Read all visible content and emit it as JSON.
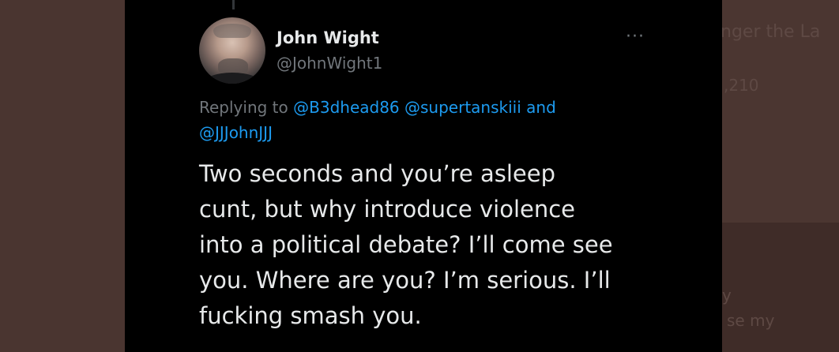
{
  "tweet": {
    "author_name": "John Wight",
    "author_handle": "@JohnWight1",
    "more_icon": "more-dots-icon",
    "replying_prefix": "Replying to",
    "mentions": [
      "@B3dhead86",
      "@supertanskiii"
    ],
    "mentions_joiner": "and",
    "mentions_last": "@JJJohnJJJ",
    "text": "Two seconds and you’re asleep\ncunt, but why  introduce violence\ninto a political debate? I’ll come see\nyou. Where are you? I’m serious. I’ll\nfucking smash you."
  },
  "background": {
    "snippet_1": "nger the La",
    "snippet_2": ",210",
    "snippet_3": "y",
    "snippet_4": "se my"
  }
}
